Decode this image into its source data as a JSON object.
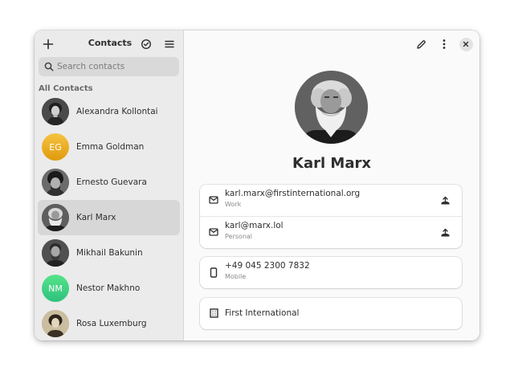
{
  "sidebar": {
    "title": "Contacts",
    "search_placeholder": "Search contacts",
    "section_label": "All Contacts",
    "contacts": [
      {
        "name": "Alexandra Kollontai",
        "initials": "",
        "avatar": "photo"
      },
      {
        "name": "Emma Goldman",
        "initials": "EG",
        "avatar": "initials",
        "color": "#e5a50a"
      },
      {
        "name": "Ernesto Guevara",
        "initials": "",
        "avatar": "photo"
      },
      {
        "name": "Karl Marx",
        "initials": "",
        "avatar": "photo",
        "selected": true
      },
      {
        "name": "Mikhail Bakunin",
        "initials": "",
        "avatar": "photo"
      },
      {
        "name": "Nestor Makhno",
        "initials": "NM",
        "avatar": "initials",
        "color": "#33d17a"
      },
      {
        "name": "Rosa Luxemburg",
        "initials": "",
        "avatar": "photo"
      }
    ]
  },
  "header": {
    "add_icon": "plus-icon",
    "select_icon": "check-circle-icon",
    "menu_icon": "hamburger-icon",
    "edit_icon": "pencil-icon",
    "more_icon": "vertical-dots-icon",
    "close_icon": "close-icon"
  },
  "detail": {
    "name": "Karl Marx",
    "emails": [
      {
        "value": "karl.marx@firstinternational.org",
        "label": "Work"
      },
      {
        "value": "karl@marx.lol",
        "label": "Personal"
      }
    ],
    "phone": {
      "value": "+49 045 2300 7832",
      "label": "Mobile"
    },
    "organization": "First International"
  },
  "colors": {
    "sidebar_bg": "#ebebeb",
    "selected_row": "#d7d7d7",
    "content_bg": "#fafafa",
    "card_bg": "#ffffff"
  }
}
